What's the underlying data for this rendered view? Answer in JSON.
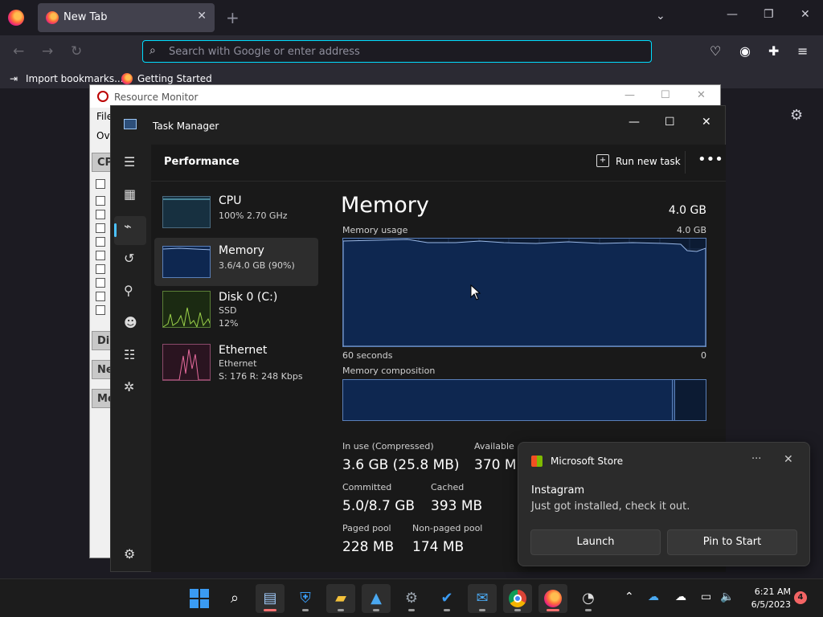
{
  "browser": {
    "tab_title": "New Tab",
    "url_placeholder": "Search with Google or enter address",
    "bookmarks": [
      "Import bookmarks...",
      "Getting Started"
    ]
  },
  "resource_monitor": {
    "title": "Resource Monitor",
    "menu_file": "File",
    "tab_overview": "Ov",
    "sections": [
      "CPU",
      "Dis",
      "Ne",
      "Me"
    ]
  },
  "task_manager": {
    "title": "Task Manager",
    "page_title": "Performance",
    "run_new_task": "Run new task",
    "perf_items": [
      {
        "name": "CPU",
        "sub1": "100%  2.70 GHz",
        "sub2": ""
      },
      {
        "name": "Memory",
        "sub1": "3.6/4.0 GB (90%)",
        "sub2": ""
      },
      {
        "name": "Disk 0 (C:)",
        "sub1": "SSD",
        "sub2": "12%"
      },
      {
        "name": "Ethernet",
        "sub1": "Ethernet",
        "sub2": "S: 176  R: 248 Kbps"
      }
    ],
    "memory": {
      "title": "Memory",
      "total": "4.0 GB",
      "usage_label": "Memory usage",
      "usage_max": "4.0 GB",
      "time_left": "60 seconds",
      "time_right": "0",
      "composition_label": "Memory composition",
      "usage_fraction": 0.9,
      "stats": [
        {
          "label": "In use (Compressed)",
          "value": "3.6 GB (25.8 MB)"
        },
        {
          "label": "Available",
          "value": "370 MB"
        },
        {
          "label": "Committed",
          "value": "5.0/8.7 GB"
        },
        {
          "label": "Cached",
          "value": "393 MB"
        },
        {
          "label": "Paged pool",
          "value": "228 MB"
        },
        {
          "label": "Non-paged pool",
          "value": "174 MB"
        }
      ]
    }
  },
  "toast": {
    "app": "Microsoft Store",
    "heading": "Instagram",
    "body": "Just got installed, check it out.",
    "launch": "Launch",
    "pin": "Pin to Start"
  },
  "taskbar": {
    "time": "6:21 AM",
    "date": "6/5/2023",
    "notifications": "4"
  },
  "colors": {
    "accent": "#4cc2ff",
    "graph_border": "#5a7fb8",
    "url_focus": "#00ddff"
  }
}
